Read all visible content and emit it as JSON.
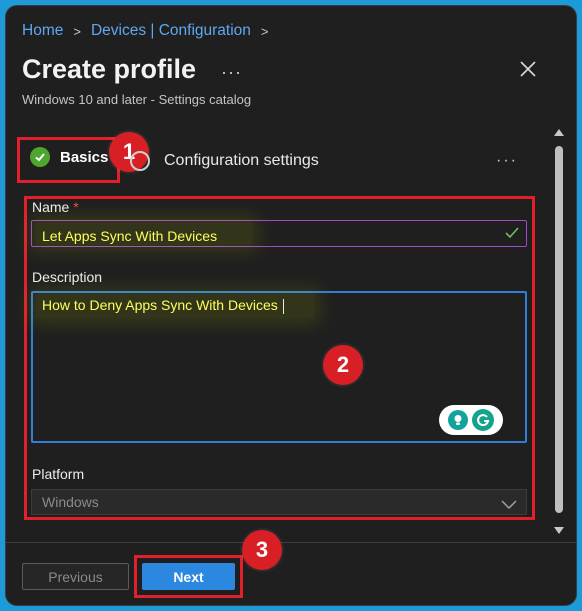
{
  "breadcrumb": {
    "home": "Home",
    "devices": "Devices | Configuration",
    "separator": ">"
  },
  "header": {
    "title": "Create profile",
    "more": "···",
    "subtitle": "Windows 10 and later - Settings catalog",
    "close_icon": "close-icon"
  },
  "steps": {
    "basics": "Basics",
    "configuration": "Configuration settings",
    "more": "···"
  },
  "form": {
    "name_label": "Name",
    "required_marker": "*",
    "name_value": "Let Apps Sync With Devices",
    "description_label": "Description",
    "description_value": "How to Deny Apps Sync With Devices",
    "platform_label": "Platform",
    "platform_value": "Windows"
  },
  "annotations": {
    "badge1": "1",
    "badge2": "2",
    "badge3": "3"
  },
  "footer": {
    "previous_label": "Previous",
    "next_label": "Next"
  },
  "colors": {
    "accent": "#2b87e0",
    "annotation_red": "#e0202c",
    "success_green": "#4ea62f",
    "link_blue": "#5fa8ef",
    "highlight_text": "#ffff5a"
  }
}
